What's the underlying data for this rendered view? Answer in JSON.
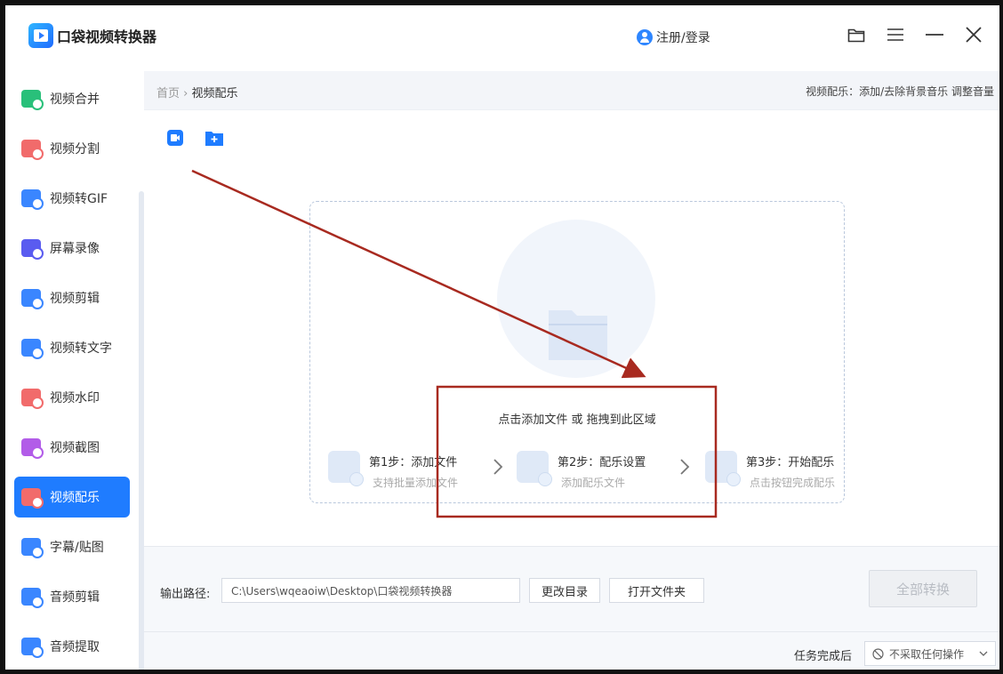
{
  "app": {
    "title": "口袋视频转换器",
    "login_label": "注册/登录"
  },
  "window_controls": [
    "folder-icon",
    "menu-icon",
    "minimize-icon",
    "close-icon"
  ],
  "sidebar": {
    "items": [
      {
        "label": "视频合并",
        "color": "#29c07a",
        "active": false
      },
      {
        "label": "视频分割",
        "color": "#f16b6b",
        "active": false
      },
      {
        "label": "视频转GIF",
        "color": "#3a86ff",
        "active": false
      },
      {
        "label": "屏幕录像",
        "color": "#5a5cf0",
        "active": false
      },
      {
        "label": "视频剪辑",
        "color": "#3a86ff",
        "active": false
      },
      {
        "label": "视频转文字",
        "color": "#3a86ff",
        "active": false
      },
      {
        "label": "视频水印",
        "color": "#f16b6b",
        "active": false
      },
      {
        "label": "视频截图",
        "color": "#b25ce8",
        "active": false
      },
      {
        "label": "视频配乐",
        "color": "#f16b6b",
        "active": true
      },
      {
        "label": "字幕/贴图",
        "color": "#3a86ff",
        "active": false
      },
      {
        "label": "音频剪辑",
        "color": "#3a86ff",
        "active": false
      },
      {
        "label": "音频提取",
        "color": "#3a86ff",
        "active": false
      }
    ]
  },
  "breadcrumb": {
    "home": "首页",
    "separator": "›",
    "current": "视频配乐"
  },
  "hint": "视频配乐：添加/去除背景音乐 调整音量",
  "dropzone": {
    "text": "点击添加文件 或 拖拽到此区域",
    "steps": [
      {
        "title": "第1步：添加文件",
        "subtitle": "支持批量添加文件"
      },
      {
        "title": "第2步：配乐设置",
        "subtitle": "添加配乐文件"
      },
      {
        "title": "第3步：开始配乐",
        "subtitle": "点击按钮完成配乐"
      }
    ]
  },
  "output": {
    "label": "输出路径:",
    "path": "C:\\Users\\wqeaoiw\\Desktop\\口袋视频转换器",
    "change_dir_label": "更改目录",
    "open_folder_label": "打开文件夹",
    "convert_all_label": "全部转换"
  },
  "after_task": {
    "label": "任务完成后",
    "selected": "不采取任何操作"
  },
  "colors": {
    "accent": "#1f7cff",
    "annotation": "#a82a20"
  }
}
